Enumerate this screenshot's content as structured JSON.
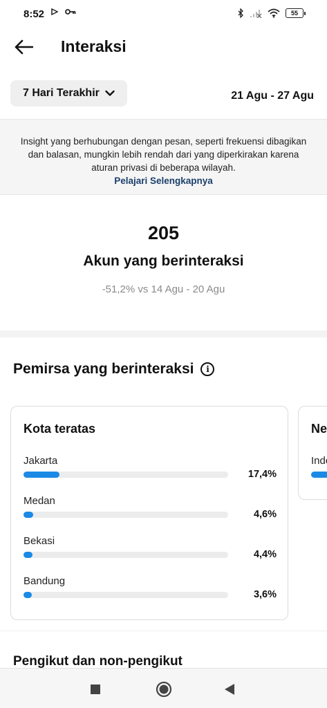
{
  "status_bar": {
    "time": "8:52",
    "battery": "55"
  },
  "header": {
    "title": "Interaksi"
  },
  "date_filter": {
    "selected": "7 Hari Terakhir",
    "range": "21 Agu - 27 Agu"
  },
  "banner": {
    "text": "Insight yang berhubungan dengan pesan, seperti frekuensi dibagikan dan balasan, mungkin lebih rendah dari yang diperkirakan karena aturan privasi di beberapa wilayah.",
    "link": "Pelajari Selengkapnya"
  },
  "summary": {
    "count": "205",
    "label": "Akun yang berinteraksi",
    "comparison": "-51,2% vs 14 Agu - 20 Agu"
  },
  "audience_section": {
    "title": "Pemirsa yang berinteraksi"
  },
  "top_cities": {
    "title": "Kota teratas",
    "items": [
      {
        "name": "Jakarta",
        "percent_label": "17,4%",
        "value": 17.4
      },
      {
        "name": "Medan",
        "percent_label": "4,6%",
        "value": 4.6
      },
      {
        "name": "Bekasi",
        "percent_label": "4,4%",
        "value": 4.4
      },
      {
        "name": "Bandung",
        "percent_label": "3,6%",
        "value": 3.6
      }
    ]
  },
  "top_countries_peek": {
    "title": "Ne",
    "item_name": "Indo"
  },
  "next_section": {
    "title": "Pengikut dan non-pengikut"
  },
  "colors": {
    "accent": "#1a8ae6",
    "link": "#1b3f6b",
    "muted": "#8a8a8a"
  },
  "icons": [
    "back-arrow-icon",
    "chevron-down-icon",
    "info-icon",
    "stop-square-icon",
    "home-circle-icon",
    "back-triangle-icon"
  ]
}
